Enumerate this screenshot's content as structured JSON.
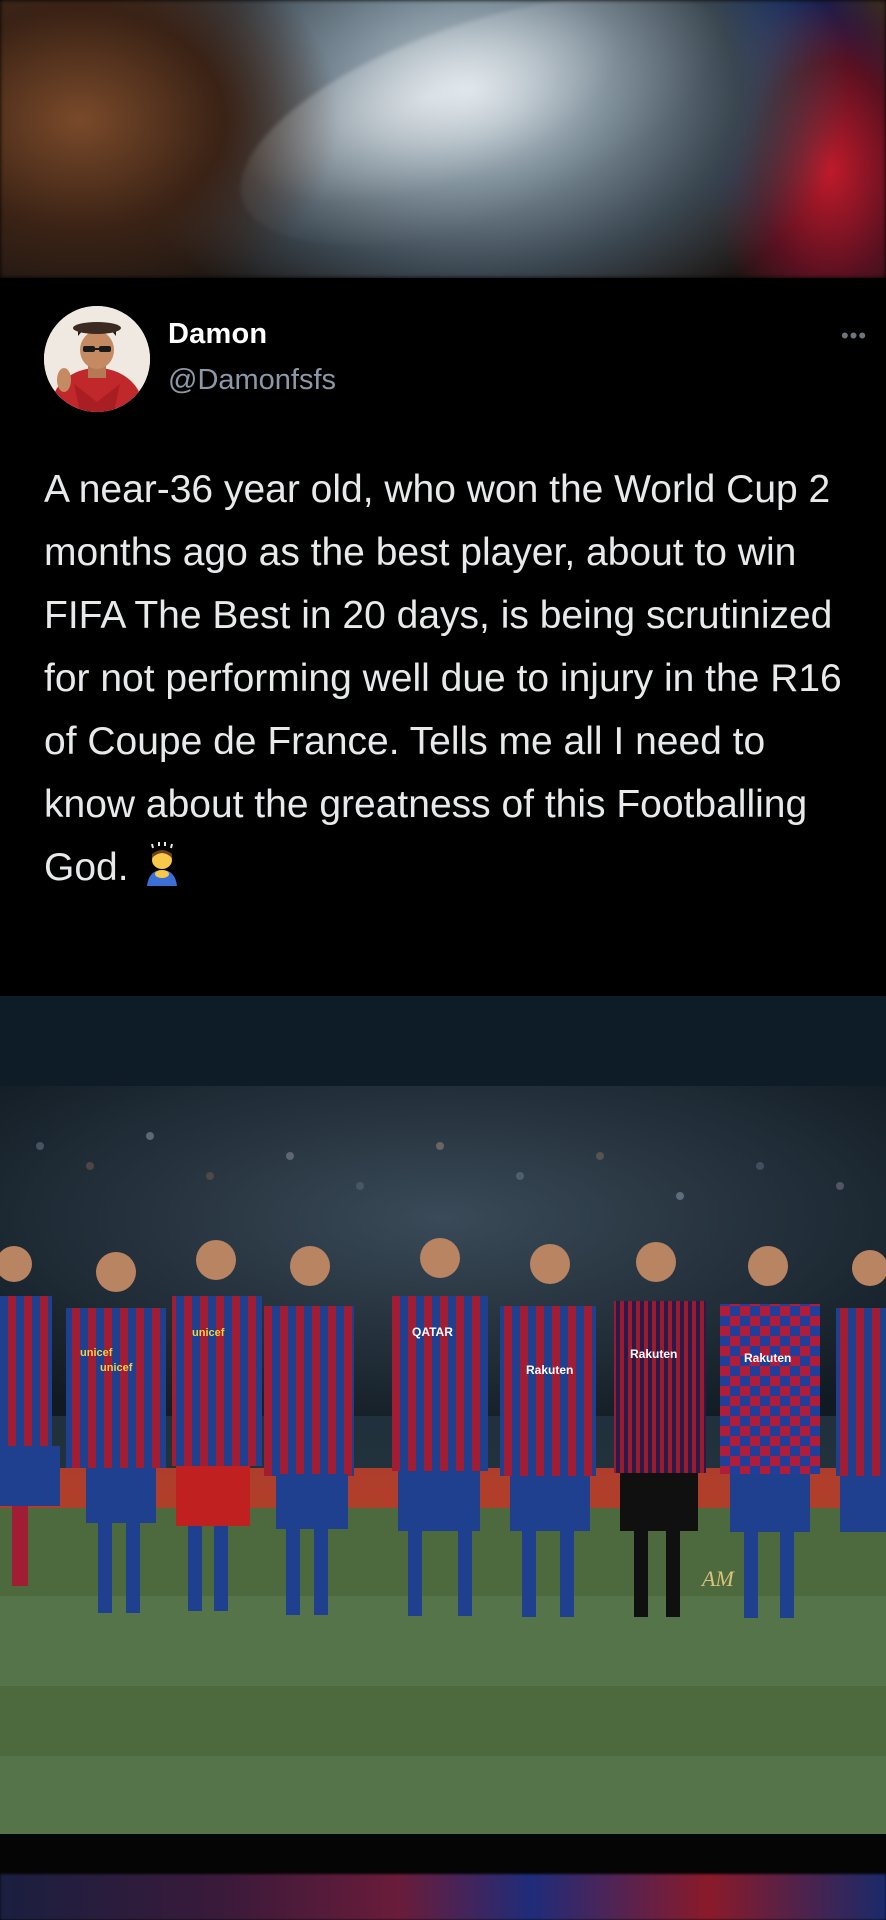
{
  "tweet": {
    "display_name": "Damon",
    "handle": "@Damonfsfs",
    "text": "A near-36 year old, who won the World Cup 2 months ago as the best player, about to win FIFA The Best in 20 days, is being scrutinized for not performing well due to injury in the R16 of Coupe de France. Tells me all I need to know about the greatness of this Footballing God.",
    "emoji": "person-bowing-emoji",
    "more_icon": "more-options-icon"
  },
  "photo": {
    "watermark": "AM",
    "shirt_sponsors": [
      "unicef",
      "unicef",
      "unicef",
      "QATAR",
      "Rakuten",
      "Rakuten",
      "Rakuten"
    ]
  },
  "colors": {
    "background": "#000000",
    "name": "#ffffff",
    "handle": "#8b98a5",
    "body_text": "#e7e9ea",
    "barca_blue": "#1f3f8f",
    "barca_red": "#a11d33"
  }
}
